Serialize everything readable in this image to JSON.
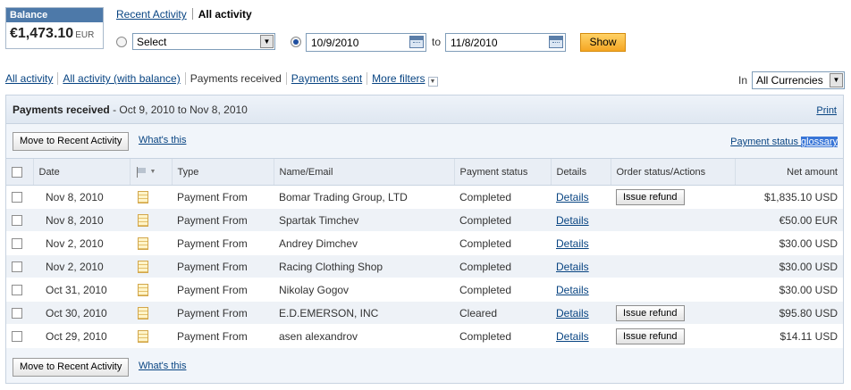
{
  "balance": {
    "label": "Balance",
    "amount": "€1,473.10",
    "currency": "EUR"
  },
  "top_tabs": {
    "recent": "Recent Activity",
    "all": "All activity"
  },
  "filters": {
    "select_value": "Select",
    "from_date": "10/9/2010",
    "to_label": "to",
    "to_date": "11/8/2010",
    "show_label": "Show"
  },
  "sub_tabs": {
    "all": "All activity",
    "all_balance": "All activity (with balance)",
    "received": "Payments received",
    "sent": "Payments sent",
    "more": "More filters"
  },
  "currency": {
    "in_label": "In",
    "value": "All Currencies"
  },
  "panel": {
    "title": "Payments received",
    "range": "- Oct 9, 2010 to Nov 8, 2010",
    "print": "Print",
    "move_button": "Move to Recent Activity",
    "whats_this": "What's this",
    "glossary_prefix": "Payment status ",
    "glossary_word": "glossary"
  },
  "table": {
    "headers": {
      "date": "Date",
      "type": "Type",
      "name": "Name/Email",
      "status": "Payment status",
      "details": "Details",
      "order": "Order status/Actions",
      "amount": "Net amount"
    },
    "rows": [
      {
        "date": "Nov 8, 2010",
        "type": "Payment From",
        "name": "Bomar Trading Group, LTD",
        "status": "Completed",
        "details": "Details",
        "action": "Issue refund",
        "amount": "$1,835.10 USD"
      },
      {
        "date": "Nov 8, 2010",
        "type": "Payment From",
        "name": "Spartak Timchev",
        "status": "Completed",
        "details": "Details",
        "action": "",
        "amount": "€50.00 EUR"
      },
      {
        "date": "Nov 2, 2010",
        "type": "Payment From",
        "name": "Andrey Dimchev",
        "status": "Completed",
        "details": "Details",
        "action": "",
        "amount": "$30.00 USD"
      },
      {
        "date": "Nov 2, 2010",
        "type": "Payment From",
        "name": "Racing Clothing Shop",
        "status": "Completed",
        "details": "Details",
        "action": "",
        "amount": "$30.00 USD"
      },
      {
        "date": "Oct 31, 2010",
        "type": "Payment From",
        "name": "Nikolay Gogov",
        "status": "Completed",
        "details": "Details",
        "action": "",
        "amount": "$30.00 USD"
      },
      {
        "date": "Oct 30, 2010",
        "type": "Payment From",
        "name": "E.D.EMERSON, INC",
        "status": "Cleared",
        "details": "Details",
        "action": "Issue refund",
        "amount": "$95.80 USD"
      },
      {
        "date": "Oct 29, 2010",
        "type": "Payment From",
        "name": "asen alexandrov",
        "status": "Completed",
        "details": "Details",
        "action": "Issue refund",
        "amount": "$14.11 USD"
      }
    ]
  }
}
